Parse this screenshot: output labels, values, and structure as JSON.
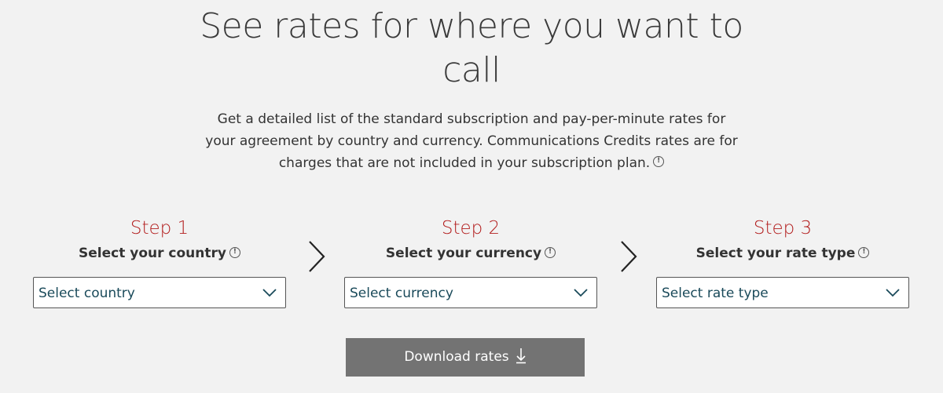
{
  "header": {
    "title_line1": "See rates for where you want to",
    "title_line2": "call"
  },
  "intro": {
    "line1": "Get a detailed list of the standard subscription and pay-per-minute rates for",
    "line2": "your agreement by country and currency. Communications Credits rates are for",
    "line3": "charges that are not included in your subscription plan.",
    "info_glyph": "!"
  },
  "steps": [
    {
      "label": "Step 1",
      "heading": "Select your country",
      "select_placeholder": "Select country"
    },
    {
      "label": "Step 2",
      "heading": "Select your currency",
      "select_placeholder": "Select currency"
    },
    {
      "label": "Step 3",
      "heading": "Select your rate type",
      "select_placeholder": "Select rate type"
    }
  ],
  "info_glyph": "!",
  "download": {
    "label": "Download rates"
  },
  "icons": {
    "info": "info-circle-icon",
    "chevron": "chevron-down-icon",
    "step_arrow": "chevron-right-icon",
    "download": "arrow-down-icon"
  },
  "colors": {
    "background": "#f2f2f2",
    "step_label": "#b31e1e",
    "select_text": "#1a4a5a",
    "button_bg": "#737373",
    "button_text": "#ffffff"
  }
}
